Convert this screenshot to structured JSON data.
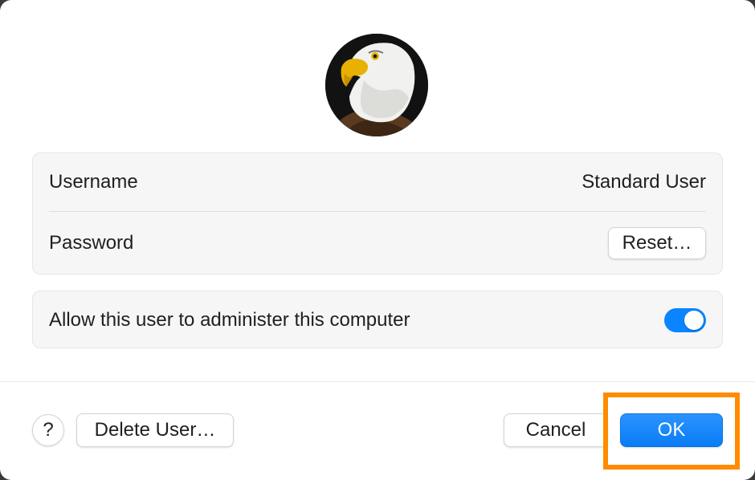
{
  "avatar": {
    "icon": "eagle-avatar"
  },
  "account": {
    "username_label": "Username",
    "username_value": "Standard User",
    "password_label": "Password",
    "reset_label": "Reset…"
  },
  "admin": {
    "allow_label": "Allow this user to administer this computer",
    "allow_enabled": true
  },
  "footer": {
    "help_label": "?",
    "delete_label": "Delete User…",
    "cancel_label": "Cancel",
    "ok_label": "OK"
  },
  "colors": {
    "accent": "#0a84ff",
    "highlight": "#ff8c00"
  }
}
